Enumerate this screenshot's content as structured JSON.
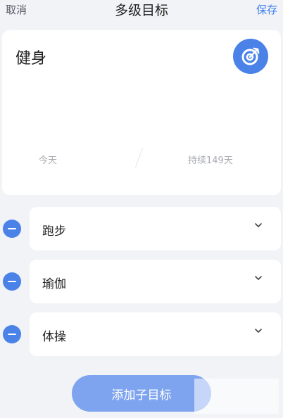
{
  "nav": {
    "cancel": "取消",
    "title": "多级目标",
    "save": "保存"
  },
  "goal": {
    "name": "健身",
    "icon": "target-icon",
    "today_label": "今天",
    "duration_label": "持续149天"
  },
  "sub_goals": [
    {
      "label": "跑步"
    },
    {
      "label": "瑜伽"
    },
    {
      "label": "体操"
    }
  ],
  "add_button": "添加子目标",
  "colors": {
    "accent": "#4a82e8",
    "save": "#3d7ef0",
    "button": "#7fa4ef",
    "background": "#f2f3f7"
  }
}
